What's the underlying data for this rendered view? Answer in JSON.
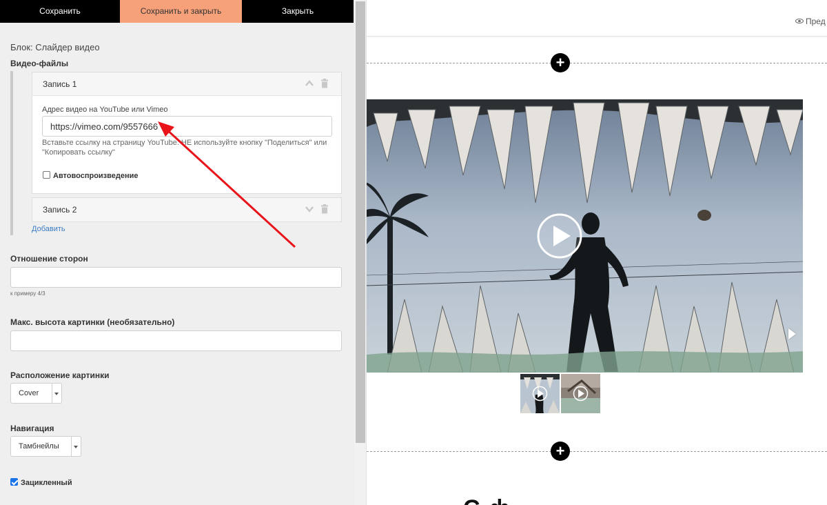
{
  "toolbar": {
    "save_label": "Сохранить",
    "save_close_label": "Сохранить и закрыть",
    "close_label": "Закрыть"
  },
  "editor": {
    "block_title": "Блок: Слайдер видео",
    "videos_label": "Видео-файлы",
    "records": [
      {
        "title": "Запись 1",
        "url_label": "Адрес видео на YouTube или Vimeo",
        "url_value": "https://vimeo.com/9557666",
        "hint_line1": "Вставьте ссылку на страницу YouTube. НЕ используйте кнопку \"Поделиться\" или",
        "hint_line2": "\"Копировать ссылку\"",
        "autoplay_label": "Автовоспроизведение",
        "autoplay_checked": false
      },
      {
        "title": "Запись 2"
      }
    ],
    "add_link": "Добавить",
    "aspect_label": "Отношение сторон",
    "aspect_value": "",
    "aspect_hint": "к примеру 4/3",
    "max_height_label": "Макс. высота картинки (необязательно)",
    "max_height_value": "",
    "position_label": "Расположение картинки",
    "position_value": "Cover",
    "nav_label": "Навигация",
    "nav_value": "Тамбнейлы",
    "loop_label": "Зацикленный",
    "loop_checked": true
  },
  "preview": {
    "preview_button": "Пред",
    "heading_fragment": "С       ф"
  },
  "colors": {
    "accent": "#f7a17a",
    "dark": "#000000",
    "link": "#3b7dc4",
    "active_thumb": "#22a0d8",
    "annotation_arrow": "#e8141a"
  },
  "icons": {
    "chevron_up": "chevron-up-icon",
    "chevron_down": "chevron-down-icon",
    "trash": "trash-icon",
    "plus": "plus-icon",
    "play": "play-icon",
    "next": "next-arrow-icon",
    "eye": "eye-icon"
  }
}
